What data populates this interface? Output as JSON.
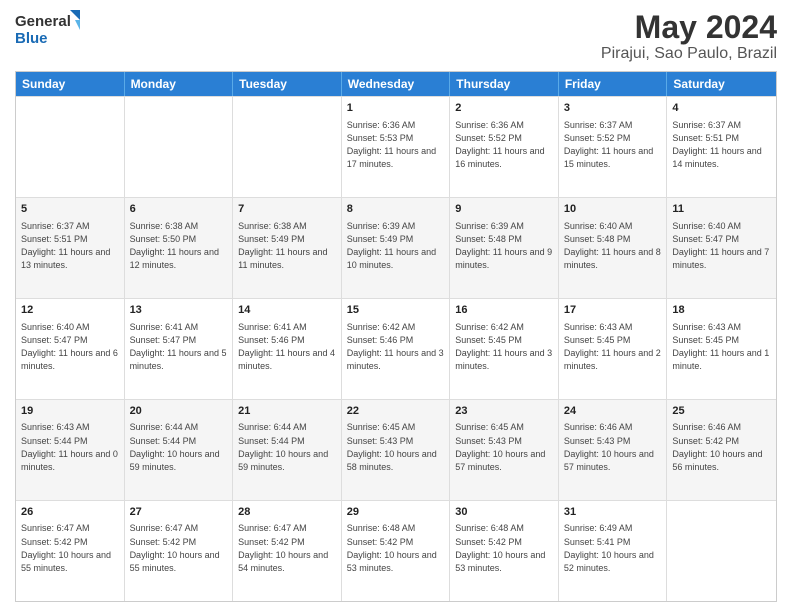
{
  "logo": {
    "line1": "General",
    "line2": "Blue"
  },
  "title": "May 2024",
  "subtitle": "Pirajui, Sao Paulo, Brazil",
  "header_days": [
    "Sunday",
    "Monday",
    "Tuesday",
    "Wednesday",
    "Thursday",
    "Friday",
    "Saturday"
  ],
  "rows": [
    {
      "alt": false,
      "cells": [
        {
          "day": "",
          "info": ""
        },
        {
          "day": "",
          "info": ""
        },
        {
          "day": "",
          "info": ""
        },
        {
          "day": "1",
          "info": "Sunrise: 6:36 AM\nSunset: 5:53 PM\nDaylight: 11 hours and 17 minutes."
        },
        {
          "day": "2",
          "info": "Sunrise: 6:36 AM\nSunset: 5:52 PM\nDaylight: 11 hours and 16 minutes."
        },
        {
          "day": "3",
          "info": "Sunrise: 6:37 AM\nSunset: 5:52 PM\nDaylight: 11 hours and 15 minutes."
        },
        {
          "day": "4",
          "info": "Sunrise: 6:37 AM\nSunset: 5:51 PM\nDaylight: 11 hours and 14 minutes."
        }
      ]
    },
    {
      "alt": true,
      "cells": [
        {
          "day": "5",
          "info": "Sunrise: 6:37 AM\nSunset: 5:51 PM\nDaylight: 11 hours and 13 minutes."
        },
        {
          "day": "6",
          "info": "Sunrise: 6:38 AM\nSunset: 5:50 PM\nDaylight: 11 hours and 12 minutes."
        },
        {
          "day": "7",
          "info": "Sunrise: 6:38 AM\nSunset: 5:49 PM\nDaylight: 11 hours and 11 minutes."
        },
        {
          "day": "8",
          "info": "Sunrise: 6:39 AM\nSunset: 5:49 PM\nDaylight: 11 hours and 10 minutes."
        },
        {
          "day": "9",
          "info": "Sunrise: 6:39 AM\nSunset: 5:48 PM\nDaylight: 11 hours and 9 minutes."
        },
        {
          "day": "10",
          "info": "Sunrise: 6:40 AM\nSunset: 5:48 PM\nDaylight: 11 hours and 8 minutes."
        },
        {
          "day": "11",
          "info": "Sunrise: 6:40 AM\nSunset: 5:47 PM\nDaylight: 11 hours and 7 minutes."
        }
      ]
    },
    {
      "alt": false,
      "cells": [
        {
          "day": "12",
          "info": "Sunrise: 6:40 AM\nSunset: 5:47 PM\nDaylight: 11 hours and 6 minutes."
        },
        {
          "day": "13",
          "info": "Sunrise: 6:41 AM\nSunset: 5:47 PM\nDaylight: 11 hours and 5 minutes."
        },
        {
          "day": "14",
          "info": "Sunrise: 6:41 AM\nSunset: 5:46 PM\nDaylight: 11 hours and 4 minutes."
        },
        {
          "day": "15",
          "info": "Sunrise: 6:42 AM\nSunset: 5:46 PM\nDaylight: 11 hours and 3 minutes."
        },
        {
          "day": "16",
          "info": "Sunrise: 6:42 AM\nSunset: 5:45 PM\nDaylight: 11 hours and 3 minutes."
        },
        {
          "day": "17",
          "info": "Sunrise: 6:43 AM\nSunset: 5:45 PM\nDaylight: 11 hours and 2 minutes."
        },
        {
          "day": "18",
          "info": "Sunrise: 6:43 AM\nSunset: 5:45 PM\nDaylight: 11 hours and 1 minute."
        }
      ]
    },
    {
      "alt": true,
      "cells": [
        {
          "day": "19",
          "info": "Sunrise: 6:43 AM\nSunset: 5:44 PM\nDaylight: 11 hours and 0 minutes."
        },
        {
          "day": "20",
          "info": "Sunrise: 6:44 AM\nSunset: 5:44 PM\nDaylight: 10 hours and 59 minutes."
        },
        {
          "day": "21",
          "info": "Sunrise: 6:44 AM\nSunset: 5:44 PM\nDaylight: 10 hours and 59 minutes."
        },
        {
          "day": "22",
          "info": "Sunrise: 6:45 AM\nSunset: 5:43 PM\nDaylight: 10 hours and 58 minutes."
        },
        {
          "day": "23",
          "info": "Sunrise: 6:45 AM\nSunset: 5:43 PM\nDaylight: 10 hours and 57 minutes."
        },
        {
          "day": "24",
          "info": "Sunrise: 6:46 AM\nSunset: 5:43 PM\nDaylight: 10 hours and 57 minutes."
        },
        {
          "day": "25",
          "info": "Sunrise: 6:46 AM\nSunset: 5:42 PM\nDaylight: 10 hours and 56 minutes."
        }
      ]
    },
    {
      "alt": false,
      "cells": [
        {
          "day": "26",
          "info": "Sunrise: 6:47 AM\nSunset: 5:42 PM\nDaylight: 10 hours and 55 minutes."
        },
        {
          "day": "27",
          "info": "Sunrise: 6:47 AM\nSunset: 5:42 PM\nDaylight: 10 hours and 55 minutes."
        },
        {
          "day": "28",
          "info": "Sunrise: 6:47 AM\nSunset: 5:42 PM\nDaylight: 10 hours and 54 minutes."
        },
        {
          "day": "29",
          "info": "Sunrise: 6:48 AM\nSunset: 5:42 PM\nDaylight: 10 hours and 53 minutes."
        },
        {
          "day": "30",
          "info": "Sunrise: 6:48 AM\nSunset: 5:42 PM\nDaylight: 10 hours and 53 minutes."
        },
        {
          "day": "31",
          "info": "Sunrise: 6:49 AM\nSunset: 5:41 PM\nDaylight: 10 hours and 52 minutes."
        },
        {
          "day": "",
          "info": ""
        }
      ]
    }
  ]
}
